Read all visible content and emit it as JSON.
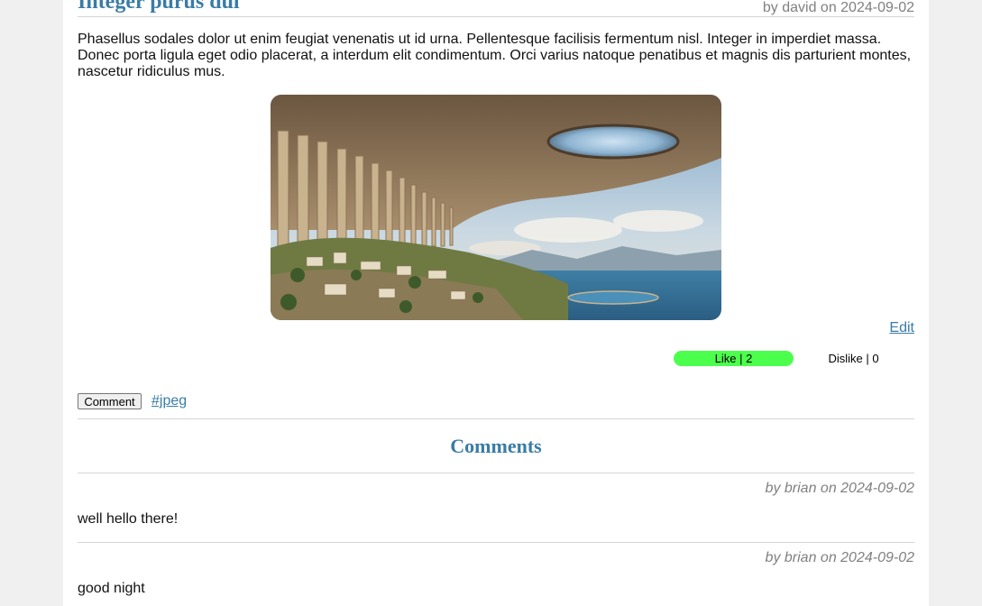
{
  "post": {
    "title": "Integer purus dui",
    "meta": "by david on 2024-09-02",
    "body": "Phasellus sodales dolor ut enim feugiat venenatis ut id urna. Pellentesque facilisis fermentum nisl. Integer in imperdiet massa. Donec porta ligula eget odio placerat, a interdum elit condimentum. Orci varius natoque penatibus et magnis dis parturient montes, nascetur ridiculus mus.",
    "edit_label": "Edit",
    "like_label": "Like | 2",
    "dislike_label": "Dislike | 0",
    "comment_button_label": "Comment",
    "tag": "#jpeg"
  },
  "comments": {
    "heading": "Comments",
    "items": [
      {
        "meta": "by brian on 2024-09-02",
        "text": "well hello there!"
      },
      {
        "meta": "by brian on 2024-09-02",
        "text": "good night"
      }
    ]
  },
  "colors": {
    "link": "#3a7ca5",
    "like_bg": "#4dff4d",
    "meta": "#808080"
  }
}
